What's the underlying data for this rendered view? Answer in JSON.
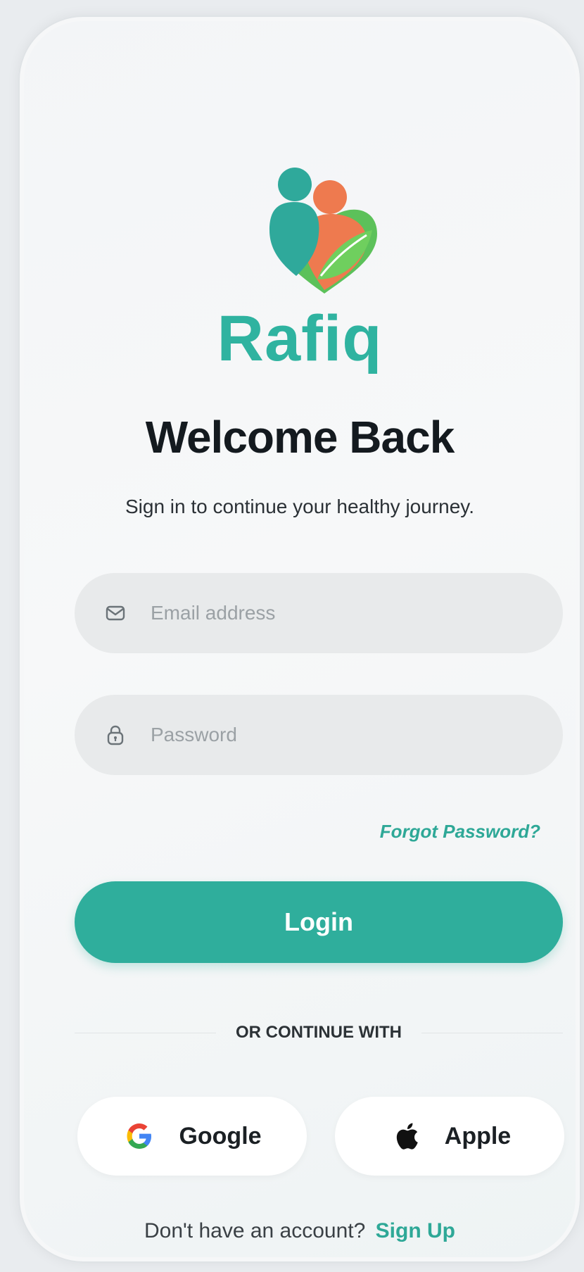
{
  "app": {
    "name": "Rafiq"
  },
  "header": {
    "title": "Welcome Back",
    "subtitle": "Sign in to continue your healthy journey."
  },
  "form": {
    "email_placeholder": "Email address",
    "password_placeholder": "Password",
    "forgot_label": "Forgot Password?",
    "login_label": "Login"
  },
  "divider": {
    "label": "OR CONTINUE WITH"
  },
  "social": {
    "google_label": "Google",
    "apple_label": "Apple"
  },
  "footer": {
    "prompt": "Don't have an account?",
    "signup_label": "Sign Up"
  },
  "icons": {
    "email": "envelope-icon",
    "password": "lock-icon",
    "google": "google-icon",
    "apple": "apple-icon"
  },
  "colors": {
    "accent": "#2fae9c",
    "brand_text": "#2fb3a0",
    "logo_orange": "#ee7a4f",
    "logo_green": "#5cc15a"
  }
}
